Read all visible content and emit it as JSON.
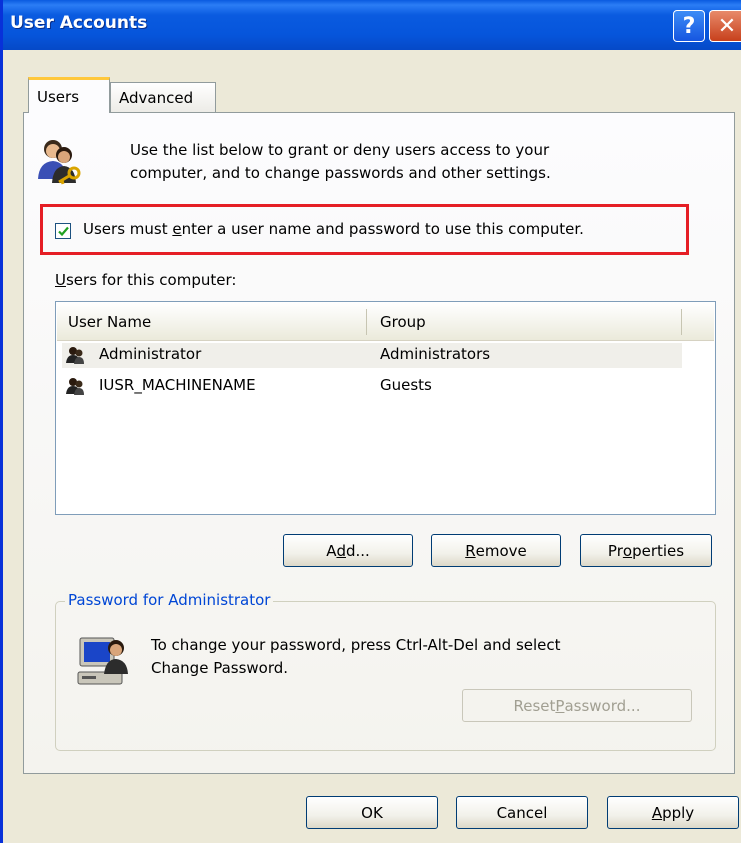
{
  "window": {
    "title": "User Accounts",
    "help_glyph": "?",
    "close_glyph": "✕"
  },
  "tabs": [
    {
      "label": "Users",
      "active": true
    },
    {
      "label": "Advanced",
      "active": false
    }
  ],
  "intro": {
    "line1": "Use the list below to grant or deny users access to your",
    "line2": "computer, and to change passwords and other settings."
  },
  "require_login": {
    "checked": true,
    "label_pre": "Users must ",
    "label_accel": "e",
    "label_post": "nter a user name and password to use this computer."
  },
  "users_list": {
    "label_accel": "U",
    "label_rest": "sers for this computer:",
    "columns": [
      "User Name",
      "Group"
    ],
    "rows": [
      {
        "name": "Administrator",
        "group": "Administrators",
        "selected": true
      },
      {
        "name": "IUSR_MACHINENAME",
        "group": "Guests",
        "selected": false
      }
    ]
  },
  "list_buttons": {
    "add": {
      "pre": "A",
      "accel": "d",
      "post": "d..."
    },
    "remove": {
      "pre": "",
      "accel": "R",
      "post": "emove"
    },
    "properties": {
      "pre": "Pr",
      "accel": "o",
      "post": "perties"
    }
  },
  "password_group": {
    "legend": "Password for Administrator",
    "line1": "To change your password, press Ctrl-Alt-Del and select",
    "line2": "Change Password.",
    "reset": {
      "pre": "Reset ",
      "accel": "P",
      "post": "assword...",
      "enabled": false
    }
  },
  "dialog_buttons": {
    "ok": "OK",
    "cancel": "Cancel",
    "apply": {
      "pre": "",
      "accel": "A",
      "post": "pply"
    }
  },
  "colors": {
    "titlebar": "#0a5be0",
    "highlight_border": "#e51e25",
    "tab_active_accent": "#ffc83c",
    "group_legend": "#0046d5"
  }
}
